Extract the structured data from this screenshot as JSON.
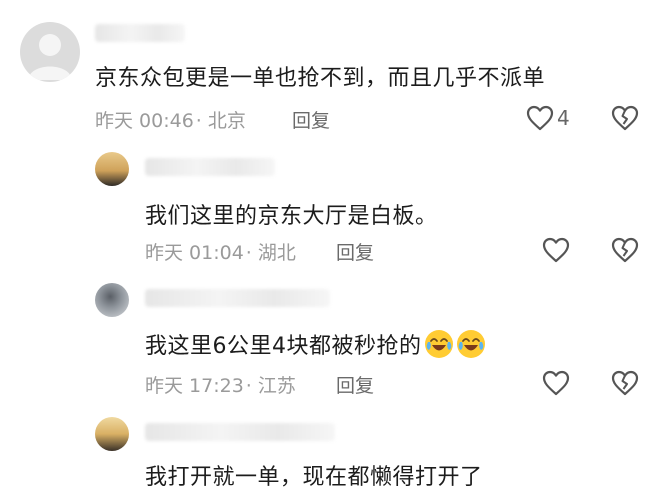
{
  "comments": [
    {
      "text": "京东众包更是一单也抢不到，而且几乎不派单",
      "time": "昨天 00:46",
      "location": "· 北京",
      "reply": "回复",
      "likes": "4"
    },
    {
      "text": "我们这里的京东大厅是白板。",
      "time": "昨天 01:04",
      "location": "· 湖北",
      "reply": "回复"
    },
    {
      "text": "我这里6公里4块都被秒抢的",
      "time": "昨天 17:23",
      "location": "· 江苏",
      "reply": "回复",
      "emojis": [
        "crying-laughing-emoji",
        "crying-laughing-emoji"
      ]
    },
    {
      "text": "我打开就一单，现在都懒得打开了"
    }
  ],
  "icons": {
    "like": "heart-outline-icon",
    "dislike": "broken-heart-icon"
  },
  "colors": {
    "text": "#1c1c1c",
    "meta": "#9a9a9a",
    "reply": "#6a6a6a",
    "icon": "#555555"
  }
}
